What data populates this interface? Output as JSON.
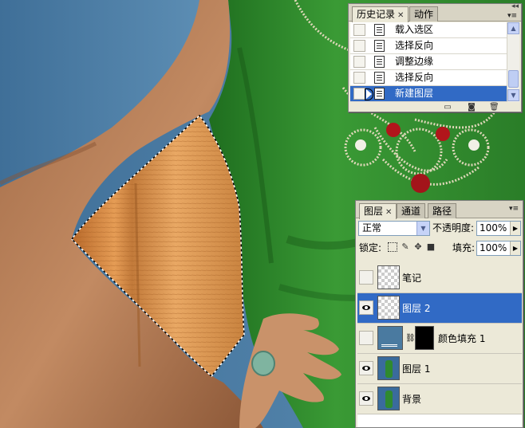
{
  "history_panel": {
    "tabs": [
      {
        "label": "历史记录",
        "active": true,
        "closable": true
      },
      {
        "label": "动作",
        "active": false,
        "closable": false
      }
    ],
    "states": [
      {
        "label": "载入选区",
        "selected": false
      },
      {
        "label": "选择反向",
        "selected": false
      },
      {
        "label": "调整边缘",
        "selected": false
      },
      {
        "label": "选择反向",
        "selected": false
      },
      {
        "label": "新建图层",
        "selected": true
      }
    ],
    "footer_icons": [
      "new-document-from-state-icon",
      "camera-snapshot-icon",
      "trash-icon"
    ]
  },
  "layers_panel": {
    "tabs": [
      {
        "label": "图层",
        "active": true,
        "closable": true
      },
      {
        "label": "通道",
        "active": false,
        "closable": false
      },
      {
        "label": "路径",
        "active": false,
        "closable": false
      }
    ],
    "blend_mode": "正常",
    "opacity_label": "不透明度:",
    "opacity_value": "100%",
    "lock_label": "锁定:",
    "lock_icons": [
      "lock-transparency-icon",
      "lock-brush-icon",
      "lock-move-icon",
      "lock-all-icon"
    ],
    "fill_label": "填充:",
    "fill_value": "100%",
    "layers": [
      {
        "name": "笔记",
        "visible": false,
        "selected": false,
        "thumb": "transparent"
      },
      {
        "name": "图层 2",
        "visible": true,
        "selected": true,
        "thumb": "transparent"
      },
      {
        "name": "颜色填充 1",
        "visible": false,
        "selected": false,
        "thumb": "fill"
      },
      {
        "name": "图层 1",
        "visible": true,
        "selected": false,
        "thumb": "photo"
      },
      {
        "name": "背景",
        "visible": true,
        "selected": false,
        "thumb": "photo"
      }
    ]
  },
  "colors": {
    "selection_blue": "#316ac5",
    "panel_bg": "#ece9d8",
    "backdrop_blue": "#4d7fa8",
    "dress_green": "#2f8a2f",
    "wood_orange": "#d98a3e",
    "skin": "#c08a62"
  }
}
